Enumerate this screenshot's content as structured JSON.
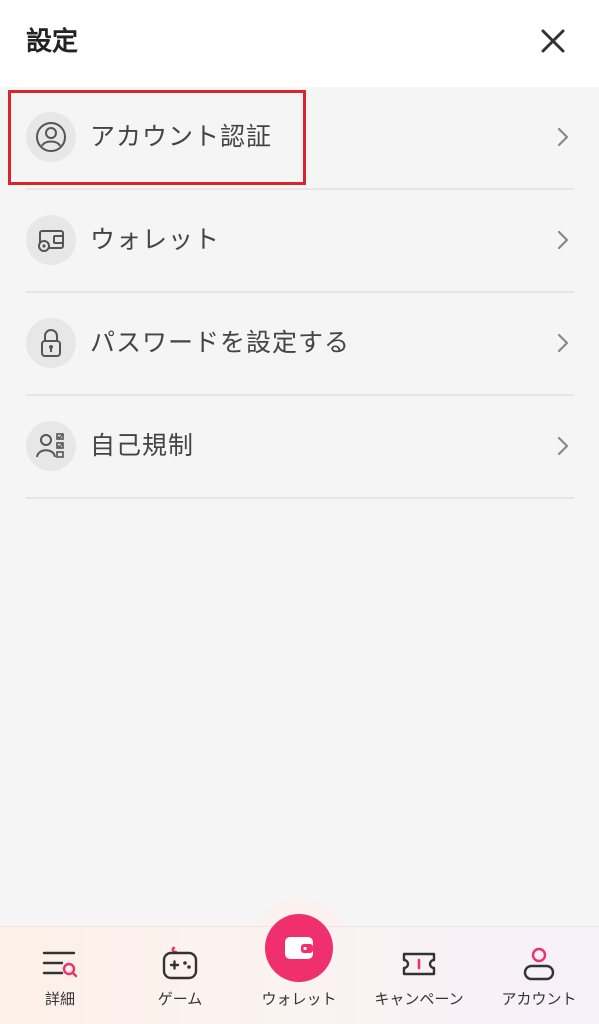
{
  "header": {
    "title": "設定"
  },
  "menu": {
    "items": [
      {
        "label": "アカウント認証",
        "icon": "user-circle-icon"
      },
      {
        "label": "ウォレット",
        "icon": "wallet-gear-icon"
      },
      {
        "label": "パスワードを設定する",
        "icon": "lock-icon"
      },
      {
        "label": "自己規制",
        "icon": "user-checklist-icon"
      }
    ]
  },
  "tabbar": {
    "items": [
      {
        "label": "詳細",
        "icon": "menu-search-icon"
      },
      {
        "label": "ゲーム",
        "icon": "gamepad-icon"
      },
      {
        "label": "ウォレット",
        "icon": "wallet-icon"
      },
      {
        "label": "キャンペーン",
        "icon": "ticket-icon"
      },
      {
        "label": "アカウント",
        "icon": "account-icon"
      }
    ]
  },
  "colors": {
    "accent": "#f0306e",
    "highlight": "#d9262c",
    "background": "#f5f5f5"
  }
}
